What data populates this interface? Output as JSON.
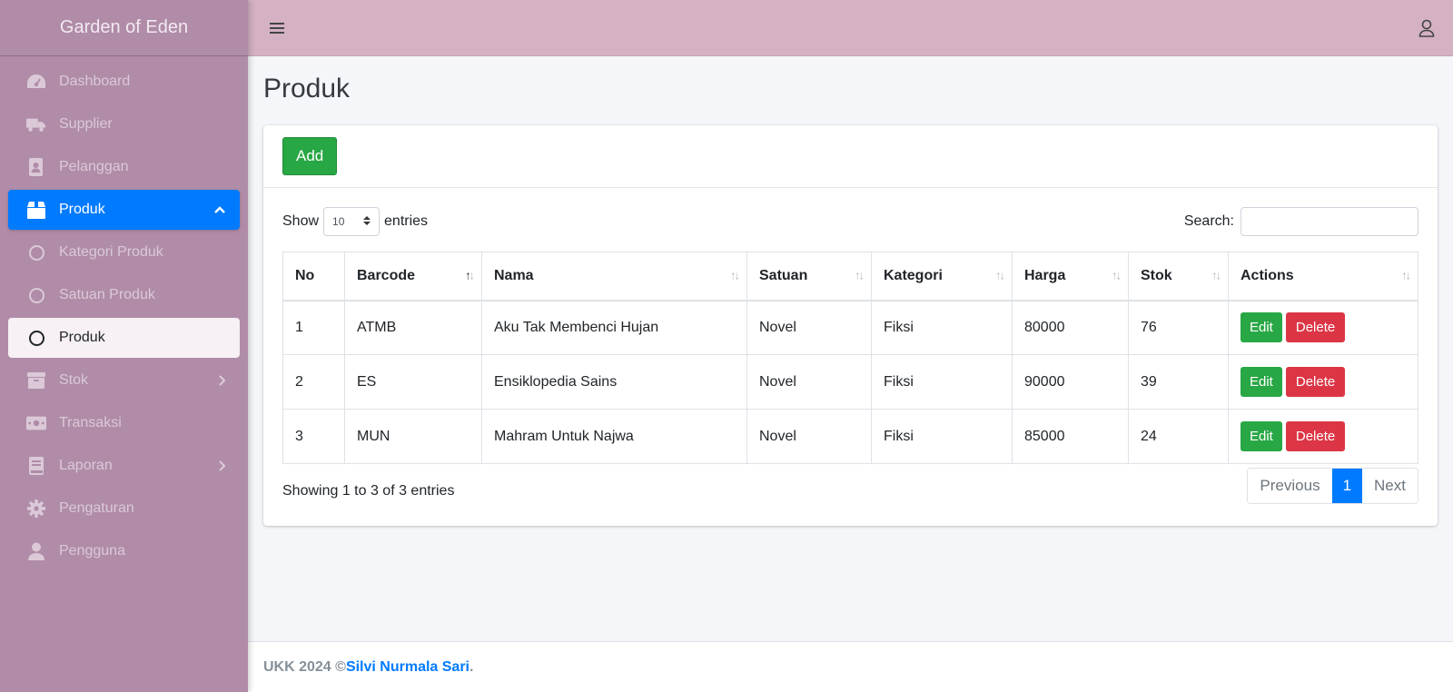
{
  "app": {
    "brand": "Garden of Eden"
  },
  "sidebar": {
    "items": [
      {
        "label": "Dashboard",
        "icon": "dashboard-icon"
      },
      {
        "label": "Supplier",
        "icon": "truck-icon"
      },
      {
        "label": "Pelanggan",
        "icon": "address-book-icon"
      },
      {
        "label": "Produk",
        "icon": "box-icon"
      },
      {
        "label": "Kategori Produk",
        "icon": "circle-icon"
      },
      {
        "label": "Satuan Produk",
        "icon": "circle-icon"
      },
      {
        "label": "Produk",
        "icon": "circle-icon"
      },
      {
        "label": "Stok",
        "icon": "archive-icon"
      },
      {
        "label": "Transaksi",
        "icon": "money-bill-icon"
      },
      {
        "label": "Laporan",
        "icon": "book-icon"
      },
      {
        "label": "Pengaturan",
        "icon": "gear-icon"
      },
      {
        "label": "Pengguna",
        "icon": "user-icon"
      }
    ]
  },
  "header": {
    "menu_icon": "hamburger-menu-icon",
    "user_icon": "user-icon"
  },
  "page": {
    "title": "Produk"
  },
  "card": {
    "add_label": "Add",
    "show_label": "Show",
    "entries_value": "10",
    "entries_label": "entries",
    "search_label": "Search:",
    "search_value": "",
    "info": "Showing 1 to 3 of 3 entries",
    "pagination": {
      "previous": "Previous",
      "current": "1",
      "next": "Next"
    }
  },
  "table": {
    "columns": [
      "No",
      "Barcode",
      "Nama",
      "Satuan",
      "Kategori",
      "Harga",
      "Stok",
      "Actions"
    ],
    "rows": [
      {
        "no": "1",
        "barcode": "ATMB",
        "nama": "Aku Tak Membenci Hujan",
        "satuan": "Novel",
        "kategori": "Fiksi",
        "harga": "80000",
        "stok": "76"
      },
      {
        "no": "2",
        "barcode": "ES",
        "nama": "Ensiklopedia Sains",
        "satuan": "Novel",
        "kategori": "Fiksi",
        "harga": "90000",
        "stok": "39"
      },
      {
        "no": "3",
        "barcode": "MUN",
        "nama": "Mahram Untuk Najwa",
        "satuan": "Novel",
        "kategori": "Fiksi",
        "harga": "85000",
        "stok": "24"
      }
    ],
    "edit_label": "Edit",
    "delete_label": "Delete"
  },
  "footer": {
    "text": "UKK 2024 ©",
    "author": "Silvi Nurmala Sari",
    "suffix": "."
  },
  "colors": {
    "sidebar": "#b08ca8",
    "topbar": "#d4b1c3",
    "active": "#007bff",
    "success": "#28a745",
    "danger": "#dc3545"
  }
}
